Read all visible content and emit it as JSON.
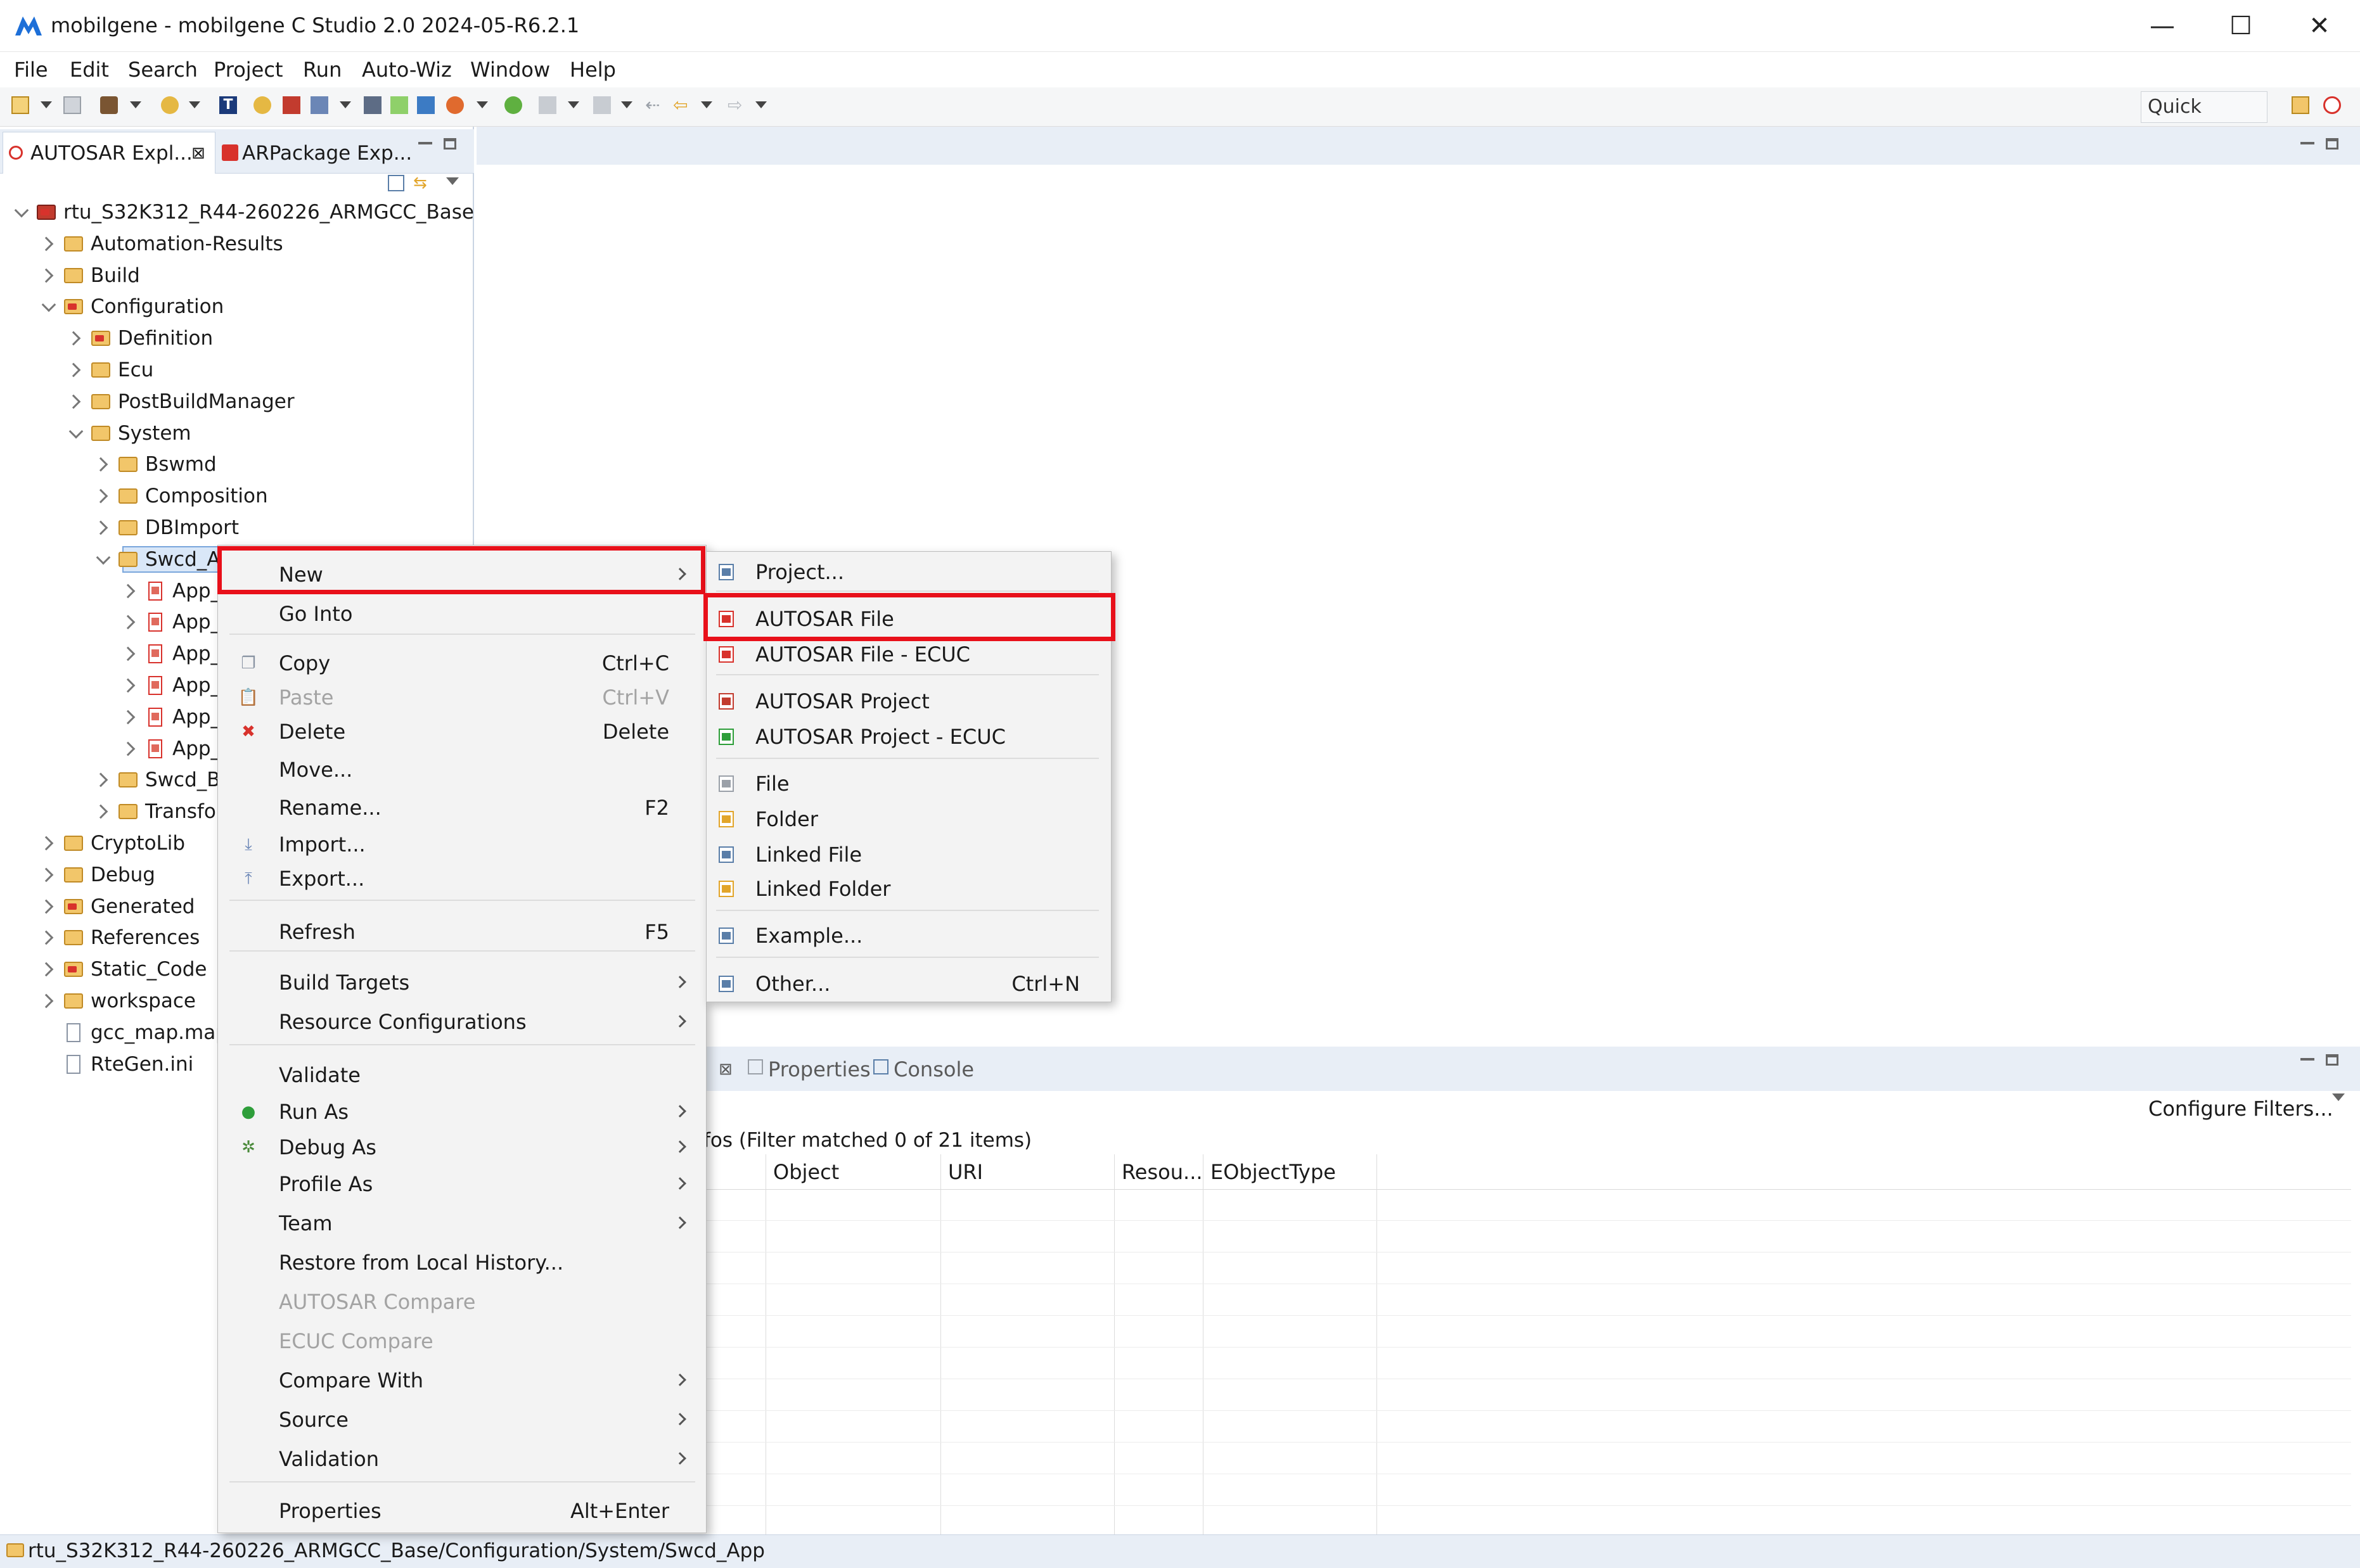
{
  "window": {
    "title": "mobilgene - mobilgene C Studio 2.0 2024-05-R6.2.1",
    "minimize_glyph": "—",
    "maximize_glyph": "☐",
    "close_glyph": "✕"
  },
  "menubar": [
    "File",
    "Edit",
    "Search",
    "Project",
    "Run",
    "Auto-Wiz",
    "Window",
    "Help"
  ],
  "toolbar": {
    "quick_access": "Quick Access"
  },
  "left_panel": {
    "tabs": [
      {
        "label": "AUTOSAR Expl...",
        "close": "⊠"
      },
      {
        "label": "ARPackage Exp..."
      }
    ],
    "tree": [
      {
        "label": "rtu_S32K312_R44-260226_ARMGCC_Base",
        "level": 0,
        "expanded": "down",
        "icon": "project-icon"
      },
      {
        "label": "Automation-Results",
        "level": 1,
        "expanded": "right",
        "icon": "folder-icon"
      },
      {
        "label": "Build",
        "level": 1,
        "expanded": "right",
        "icon": "folder-icon"
      },
      {
        "label": "Configuration",
        "level": 1,
        "expanded": "down",
        "icon": "autosar-folder-icon"
      },
      {
        "label": "Definition",
        "level": 2,
        "expanded": "right",
        "icon": "autosar-folder-icon"
      },
      {
        "label": "Ecu",
        "level": 2,
        "expanded": "right",
        "icon": "folder-icon"
      },
      {
        "label": "PostBuildManager",
        "level": 2,
        "expanded": "right",
        "icon": "folder-icon"
      },
      {
        "label": "System",
        "level": 2,
        "expanded": "down",
        "icon": "folder-icon"
      },
      {
        "label": "Bswmd",
        "level": 3,
        "expanded": "right",
        "icon": "folder-icon"
      },
      {
        "label": "Composition",
        "level": 3,
        "expanded": "right",
        "icon": "folder-icon"
      },
      {
        "label": "DBImport",
        "level": 3,
        "expanded": "right",
        "icon": "folder-icon"
      },
      {
        "label": "Swcd_A",
        "level": 3,
        "expanded": "down",
        "icon": "folder-icon",
        "selected": "true"
      },
      {
        "label": "App_",
        "level": 4,
        "expanded": "right",
        "icon": "autosar-file-icon"
      },
      {
        "label": "App_",
        "level": 4,
        "expanded": "right",
        "icon": "autosar-file-icon"
      },
      {
        "label": "App_",
        "level": 4,
        "expanded": "right",
        "icon": "autosar-file-icon"
      },
      {
        "label": "App_",
        "level": 4,
        "expanded": "right",
        "icon": "autosar-file-icon"
      },
      {
        "label": "App_",
        "level": 4,
        "expanded": "right",
        "icon": "autosar-file-icon"
      },
      {
        "label": "App_",
        "level": 4,
        "expanded": "right",
        "icon": "autosar-file-icon"
      },
      {
        "label": "Swcd_Bs",
        "level": 3,
        "expanded": "right",
        "icon": "folder-icon"
      },
      {
        "label": "Transfor",
        "level": 3,
        "expanded": "right",
        "icon": "folder-icon"
      },
      {
        "label": "CryptoLib",
        "level": 1,
        "expanded": "right",
        "icon": "folder-icon"
      },
      {
        "label": "Debug",
        "level": 1,
        "expanded": "right",
        "icon": "folder-icon"
      },
      {
        "label": "Generated",
        "level": 1,
        "expanded": "right",
        "icon": "autosar-folder-icon"
      },
      {
        "label": "References",
        "level": 1,
        "expanded": "right",
        "icon": "folder-icon"
      },
      {
        "label": "Static_Code",
        "level": 1,
        "expanded": "right",
        "icon": "autosar-folder-icon"
      },
      {
        "label": "workspace",
        "level": 1,
        "expanded": "right",
        "icon": "folder-icon"
      },
      {
        "label": "gcc_map.map",
        "level": 1,
        "expanded": "none",
        "icon": "file-icon"
      },
      {
        "label": "RteGen.ini",
        "level": 1,
        "expanded": "none",
        "icon": "file-icon"
      }
    ]
  },
  "bottom_panel": {
    "tabs": [
      {
        "label": "Properties",
        "icon": "properties-icon"
      },
      {
        "label": "Console",
        "icon": "console-icon"
      }
    ],
    "close_glyph": "⊠",
    "configure_filters": "Configure Filters...",
    "filter_text": "fos (Filter matched 0 of 21 items)",
    "columns": [
      "Object",
      "URI",
      "Resou...",
      "EObjectType"
    ]
  },
  "status_bar": {
    "path": "rtu_S32K312_R44-260226_ARMGCC_Base/Configuration/System/Swcd_App"
  },
  "context_menu": {
    "items": [
      {
        "label": "New",
        "has_submenu": "yes",
        "highlighted": "yes"
      },
      {
        "label": "Go Into"
      },
      {
        "sep": "yes"
      },
      {
        "label": "Copy",
        "shortcut": "Ctrl+C",
        "icon": "copy-icon"
      },
      {
        "label": "Paste",
        "shortcut": "Ctrl+V",
        "icon": "paste-icon",
        "disabled": "yes"
      },
      {
        "label": "Delete",
        "shortcut": "Delete",
        "icon": "delete-icon"
      },
      {
        "label": "Move..."
      },
      {
        "label": "Rename...",
        "shortcut": "F2"
      },
      {
        "label": "Import...",
        "icon": "import-icon"
      },
      {
        "label": "Export...",
        "icon": "export-icon"
      },
      {
        "sep": "yes"
      },
      {
        "label": "Refresh",
        "shortcut": "F5"
      },
      {
        "sep": "yes"
      },
      {
        "label": "Build Targets",
        "has_submenu": "yes"
      },
      {
        "label": "Resource Configurations",
        "has_submenu": "yes"
      },
      {
        "sep": "yes"
      },
      {
        "label": "Validate"
      },
      {
        "label": "Run As",
        "has_submenu": "yes",
        "icon": "run-icon"
      },
      {
        "label": "Debug As",
        "has_submenu": "yes",
        "icon": "debug-icon"
      },
      {
        "label": "Profile As",
        "has_submenu": "yes"
      },
      {
        "label": "Team",
        "has_submenu": "yes"
      },
      {
        "label": "Restore from Local History..."
      },
      {
        "label": "AUTOSAR Compare",
        "disabled": "yes"
      },
      {
        "label": "ECUC Compare",
        "disabled": "yes"
      },
      {
        "label": "Compare With",
        "has_submenu": "yes"
      },
      {
        "label": "Source",
        "has_submenu": "yes"
      },
      {
        "label": "Validation",
        "has_submenu": "yes"
      },
      {
        "sep": "yes"
      },
      {
        "label": "Properties",
        "shortcut": "Alt+Enter"
      }
    ]
  },
  "submenu_new": {
    "items": [
      {
        "label": "Project...",
        "icon": "project-wizard-icon"
      },
      {
        "sep": "yes"
      },
      {
        "label": "AUTOSAR File",
        "icon": "autosar-file-icon",
        "highlighted": "yes"
      },
      {
        "label": "AUTOSAR File - ECUC",
        "icon": "autosar-ecuc-file-icon"
      },
      {
        "sep": "yes"
      },
      {
        "label": "AUTOSAR Project",
        "icon": "autosar-project-icon"
      },
      {
        "label": "AUTOSAR Project - ECUC",
        "icon": "autosar-ecuc-project-icon"
      },
      {
        "sep": "yes"
      },
      {
        "label": "File",
        "icon": "new-file-icon"
      },
      {
        "label": "Folder",
        "icon": "new-folder-icon"
      },
      {
        "label": "Linked File",
        "icon": "linked-file-icon"
      },
      {
        "label": "Linked Folder",
        "icon": "linked-folder-icon"
      },
      {
        "sep": "yes"
      },
      {
        "label": "Example...",
        "icon": "example-icon"
      },
      {
        "sep": "yes"
      },
      {
        "label": "Other...",
        "shortcut": "Ctrl+N",
        "icon": "other-icon"
      }
    ]
  },
  "colors": {
    "highlight_red": "#e8101a",
    "panel_blue": "#e8eef6"
  }
}
